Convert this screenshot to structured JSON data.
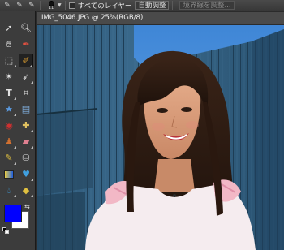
{
  "options_bar": {
    "brush_size": "11",
    "all_layers_label": "すべてのレイヤー",
    "auto_adjust_label": "自動調整",
    "refine_edge_label": "境界線を調整..."
  },
  "document": {
    "title": "IMG_5046.JPG @ 25%(RGB/8)"
  },
  "colors": {
    "foreground": "#0000ff",
    "background": "#ffffff"
  },
  "tools": [
    "move-tool-icon",
    "zoom-tool-icon",
    "hand-tool-icon",
    "eyedropper-tool-icon",
    "marquee-tool-icon",
    "quick-selection-tool-icon",
    "magic-wand-tool-icon",
    "lasso-tool-icon",
    "text-tool-icon",
    "crop-tool-icon",
    "shape-tool-icon",
    "cookie-cutter-tool-icon",
    "red-eye-tool-icon",
    "healing-brush-tool-icon",
    "clone-stamp-tool-icon",
    "eraser-tool-icon",
    "brush-tool-icon",
    "paint-bucket-tool-icon",
    "gradient-tool-icon",
    "smart-brush-tool-icon",
    "blur-tool-icon",
    "sponge-tool-icon"
  ]
}
